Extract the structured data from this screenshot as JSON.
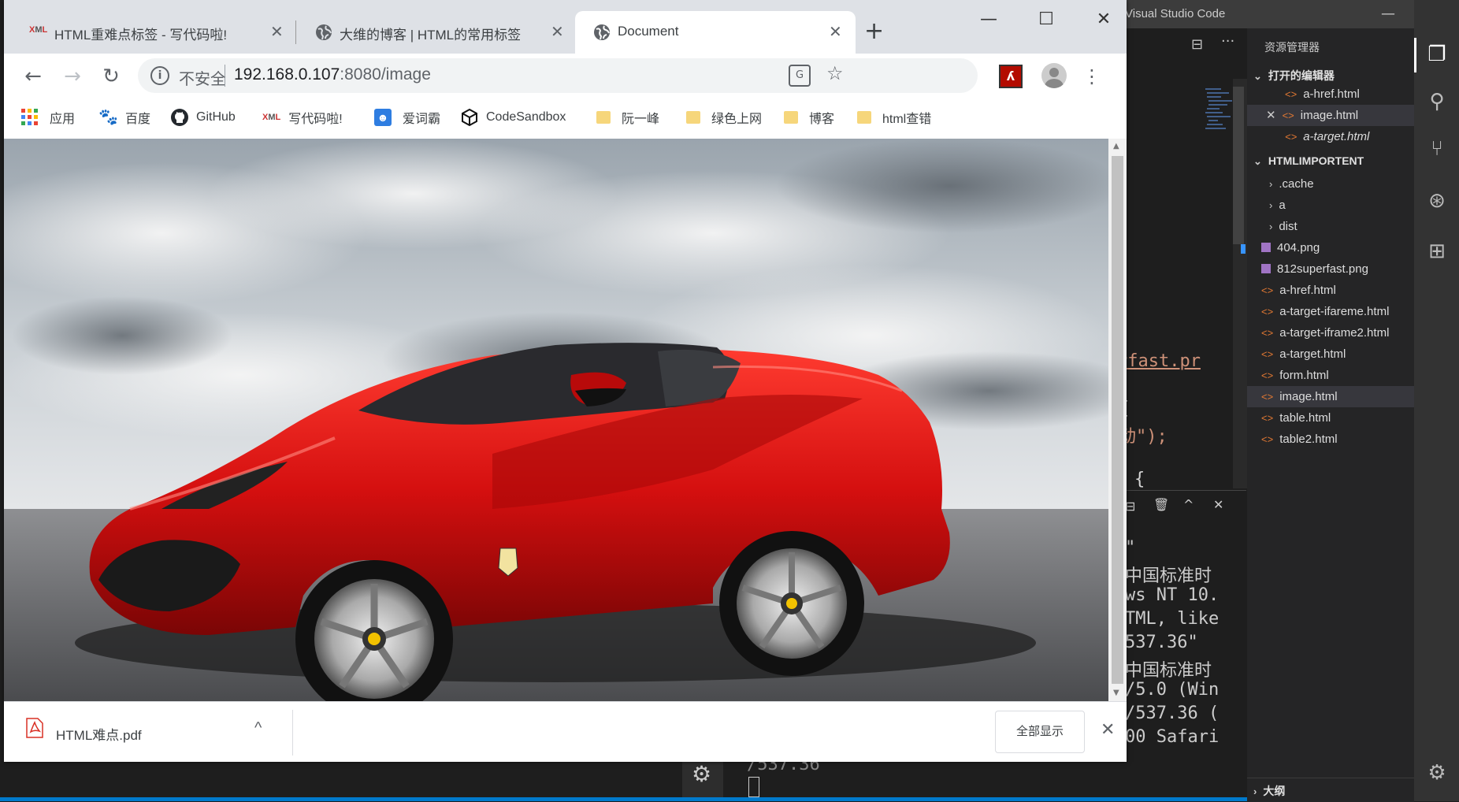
{
  "vscode": {
    "window_title": "Visual Studio Code",
    "code_fragments": [
      "rfast.pr",
      "{",
      "动\");",
      "{",
      ";"
    ],
    "terminal_lines": [
      "\"",
      "中国标准时",
      "ws NT 10.",
      "TML, like",
      "537.36\"",
      "中国标准时",
      "/5.0 (Win",
      "/537.36 (",
      "00 Safari",
      "/537.36"
    ],
    "explorer": {
      "title": "资源管理器",
      "open_editors_label": "打开的编辑器",
      "open_editors": [
        "a-href.html",
        "image.html",
        "a-target.html"
      ],
      "folder_label": "HTMLIMPORTENT",
      "folders": [
        ".cache",
        "a",
        "dist"
      ],
      "files": [
        {
          "name": "404.png",
          "type": "png"
        },
        {
          "name": "812superfast.png",
          "type": "png"
        },
        {
          "name": "a-href.html",
          "type": "html"
        },
        {
          "name": "a-target-ifareme.html",
          "type": "html"
        },
        {
          "name": "a-target-iframe2.html",
          "type": "html"
        },
        {
          "name": "a-target.html",
          "type": "html"
        },
        {
          "name": "form.html",
          "type": "html"
        },
        {
          "name": "image.html",
          "type": "html"
        },
        {
          "name": "table.html",
          "type": "html"
        },
        {
          "name": "table2.html",
          "type": "html"
        }
      ],
      "outline_label": "大纲"
    },
    "accent_color": "#007acc"
  },
  "chrome": {
    "tabs": [
      {
        "title": "HTML重难点标签 - 写代码啦!",
        "favicon": "xml-icon",
        "active": false
      },
      {
        "title": "大维的博客 | HTML的常用标签",
        "favicon": "globe-icon",
        "active": false
      },
      {
        "title": "Document",
        "favicon": "globe-icon",
        "active": true
      }
    ],
    "omnibox": {
      "security_label": "不安全",
      "url_host": "192.168.0.107",
      "url_rest": ":8080/image"
    },
    "bookmarks": [
      {
        "label": "应用",
        "icon": "apps-grid-icon"
      },
      {
        "label": "百度",
        "icon": "baidu-paw-icon"
      },
      {
        "label": "GitHub",
        "icon": "github-icon"
      },
      {
        "label": "写代码啦!",
        "icon": "xml-icon"
      },
      {
        "label": "爱词霸",
        "icon": "iciba-icon"
      },
      {
        "label": "CodeSandbox",
        "icon": "codesandbox-icon"
      },
      {
        "label": "阮一峰",
        "icon": "folder-icon"
      },
      {
        "label": "绿色上网",
        "icon": "folder-icon"
      },
      {
        "label": "博客",
        "icon": "folder-icon"
      },
      {
        "label": "html查错",
        "icon": "folder-icon"
      }
    ],
    "download": {
      "filename": "HTML难点.pdf",
      "show_all": "全部显示"
    }
  }
}
